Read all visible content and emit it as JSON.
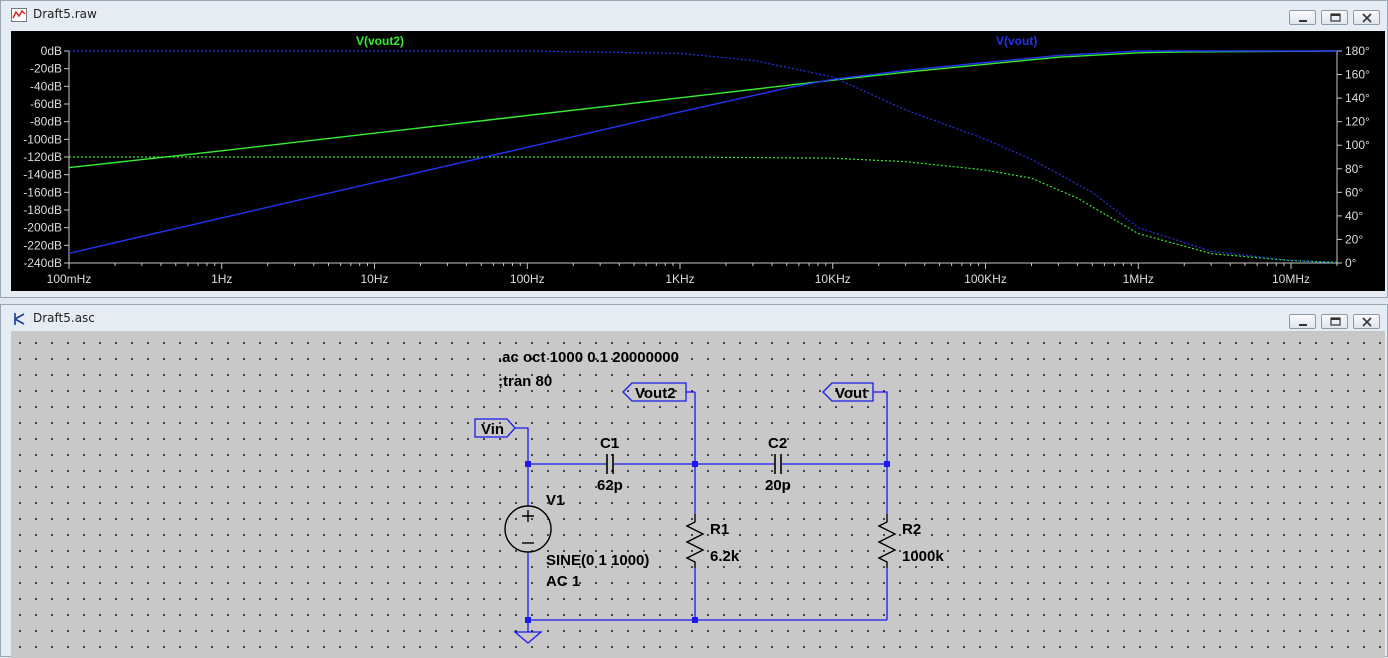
{
  "plot_window": {
    "title": "Draft5.raw",
    "trace_labels": {
      "vout2": "V(vout2)",
      "vout": "V(vout)"
    },
    "colors": {
      "vout2": "#33ee33",
      "vout": "#2233ee",
      "axis": "#c8c8c8",
      "text": "#dcdcdc"
    }
  },
  "schematic_window": {
    "title": "Draft5.asc",
    "directives": {
      "ac": ".ac oct 1000 0.1 20000000",
      "tran": ";tran 80"
    },
    "net_labels": {
      "vin": "Vin",
      "vout2": "Vout2",
      "vout": "Vout"
    },
    "components": {
      "c1": {
        "ref": "C1",
        "value": "62p"
      },
      "c2": {
        "ref": "C2",
        "value": "20p"
      },
      "r1": {
        "ref": "R1",
        "value": "6.2k"
      },
      "r2": {
        "ref": "R2",
        "value": "1000k"
      },
      "v1": {
        "ref": "V1",
        "value": "SINE(0 1 1000)",
        "ac": "AC 1"
      }
    },
    "colors": {
      "wire": "#1a1aee",
      "node": "#1a1aee"
    }
  },
  "chart_data": {
    "type": "line",
    "xscale": "log",
    "xlim": [
      0.1,
      20000000
    ],
    "x_ticks": [
      "100mHz",
      "1Hz",
      "10Hz",
      "100Hz",
      "1KHz",
      "10KHz",
      "100KHz",
      "1MHz",
      "10MHz"
    ],
    "y_left_ticks": [
      "0dB",
      "-20dB",
      "-40dB",
      "-60dB",
      "-80dB",
      "-100dB",
      "-120dB",
      "-140dB",
      "-160dB",
      "-180dB",
      "-200dB",
      "-220dB",
      "-240dB"
    ],
    "y_left_lim": [
      -240,
      0
    ],
    "y_right_ticks": [
      "180°",
      "160°",
      "140°",
      "120°",
      "100°",
      "80°",
      "60°",
      "40°",
      "20°",
      "0°"
    ],
    "y_right_lim": [
      0,
      180
    ],
    "series": [
      {
        "name": "V(vout2)",
        "magnitude_db": [
          [
            0.1,
            -132
          ],
          [
            1,
            -113
          ],
          [
            10,
            -93
          ],
          [
            100,
            -73
          ],
          [
            1000,
            -53
          ],
          [
            10000,
            -33
          ],
          [
            30000,
            -24
          ],
          [
            100000,
            -15
          ],
          [
            300000,
            -7
          ],
          [
            1000000,
            -2
          ],
          [
            2000000,
            -1
          ],
          [
            20000000,
            0
          ]
        ],
        "phase_deg": [
          [
            0.1,
            90
          ],
          [
            1000,
            90
          ],
          [
            10000,
            89
          ],
          [
            30000,
            86
          ],
          [
            100000,
            79
          ],
          [
            200000,
            72
          ],
          [
            400000,
            55
          ],
          [
            1000000,
            25
          ],
          [
            3000000,
            8
          ],
          [
            10000000,
            2
          ],
          [
            20000000,
            0.5
          ]
        ]
      },
      {
        "name": "V(vout)",
        "magnitude_db": [
          [
            0.1,
            -229
          ],
          [
            1,
            -189
          ],
          [
            10,
            -149
          ],
          [
            100,
            -109
          ],
          [
            1000,
            -69
          ],
          [
            5000,
            -42
          ],
          [
            10000,
            -32
          ],
          [
            30000,
            -22
          ],
          [
            100000,
            -13
          ],
          [
            300000,
            -5
          ],
          [
            1000000,
            0
          ],
          [
            20000000,
            0
          ]
        ],
        "phase_deg": [
          [
            0.1,
            180
          ],
          [
            100,
            180
          ],
          [
            1000,
            178
          ],
          [
            3000,
            172
          ],
          [
            10000,
            158
          ],
          [
            30000,
            130
          ],
          [
            100000,
            105
          ],
          [
            200000,
            88
          ],
          [
            500000,
            60
          ],
          [
            1000000,
            30
          ],
          [
            3000000,
            10
          ],
          [
            10000000,
            2
          ],
          [
            20000000,
            0.5
          ]
        ]
      }
    ]
  }
}
